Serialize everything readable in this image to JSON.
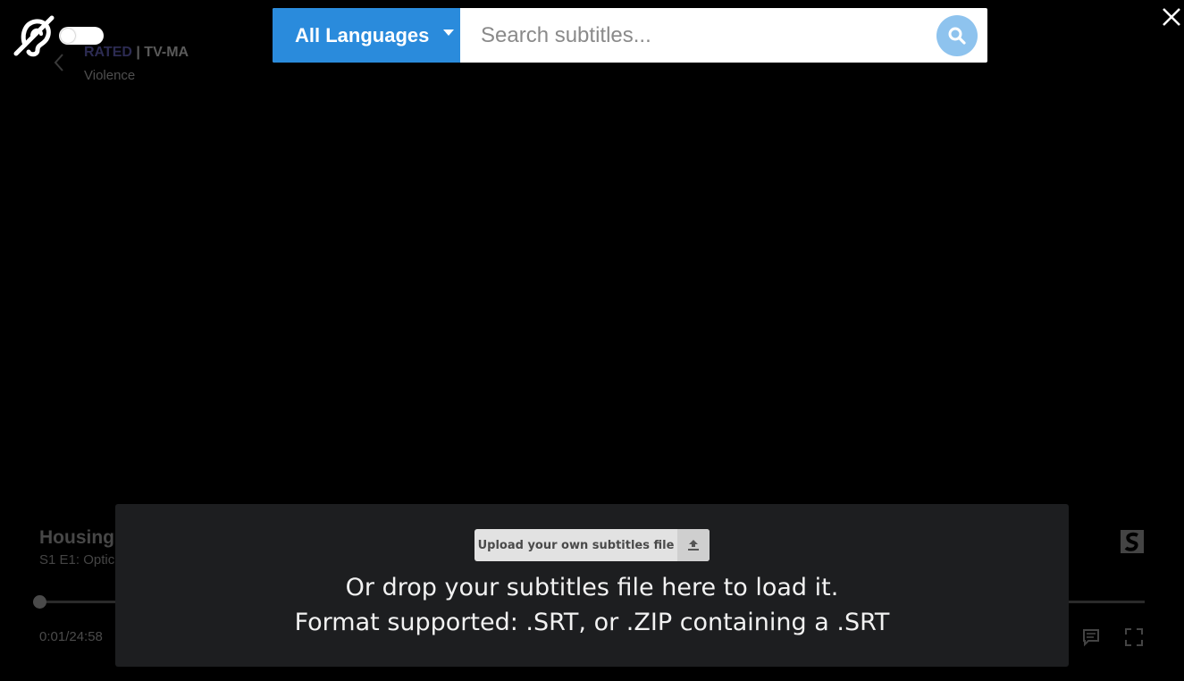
{
  "accessibility": {
    "icon": "hearing-assist-icon",
    "toggle_state": "off"
  },
  "header": {
    "rating_prefix": "RATED",
    "rating_sep": " | ",
    "rating_value": "TV-MA",
    "rating_descriptor": "Violence"
  },
  "search": {
    "language_label": "All Languages",
    "placeholder": "Search subtitles...",
    "value": ""
  },
  "player": {
    "show_title": "Housing",
    "episode_title": "S1 E1: Optic",
    "time": "0:01/24:58",
    "progress": 0.0007
  },
  "upload": {
    "button_label": "Upload your own subtitles file",
    "drop_line1": "Or drop your subtitles file here to load it.",
    "drop_line2": "Format supported: .SRT, or .ZIP containing a .SRT"
  },
  "colors": {
    "accent": "#2a8bdc",
    "search_button": "#8ec3ee",
    "panel": "#1d1e20"
  }
}
